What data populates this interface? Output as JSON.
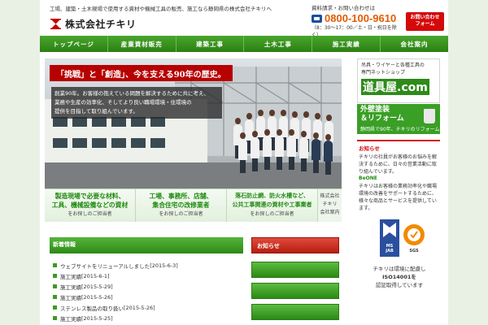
{
  "header": {
    "tagline": "工場、建築・土木現場で使用する資材や機械工具の販売、施工なら静岡県の株式会社チキリへ",
    "company_name": "株式会社チキリ",
    "contact_label": "資料請求・お問い合わせは",
    "phone": "0800-100-9610",
    "hours": "（8：30～17：00／土・日・祝日を除く）",
    "form_button": "お問い合わせ\nフォーム"
  },
  "nav": {
    "items": [
      "トップページ",
      "産業資材販売",
      "建築工事",
      "土木工事",
      "施工実績",
      "会社案内"
    ]
  },
  "hero": {
    "title": "「挑戦」と「創造」、今を支える90年の歴史。",
    "text_lines": [
      "創業90年。お客様の抱えている問題を解決するために共に考え、",
      "業務や生産の効率化、そしてより良い職場環境・住環境の",
      "提供を目指して取り組んでいます。"
    ]
  },
  "categories": [
    {
      "main": "製造現場で必要な材料、\n工具、機械設備などの資材",
      "sub": "をお探しのご担当者"
    },
    {
      "main": "工場、事務所、店舗、\n集合住宅の改修業者",
      "sub": "をお探しのご担当者"
    },
    {
      "main": "落石防止網、防火水槽など、\n公共工事関連の資材や工事業者",
      "sub": "をお探しのご担当者"
    }
  ],
  "company_info_label": "株式会社\nチキリ\n会社案内",
  "news": {
    "heading": "新着情報",
    "items": [
      {
        "title": "ウェブサイトをリニューアルしました",
        "date": "[2015-6-3]"
      },
      {
        "title": "施工実績",
        "date": "[2015-6-1]"
      },
      {
        "title": "施工実績",
        "date": "[2015-5-29]"
      },
      {
        "title": "施工実績",
        "date": "[2015-5-26]"
      },
      {
        "title": "ステンレス製品の取り扱い",
        "date": "[2015-5-26]"
      },
      {
        "title": "施工実績",
        "date": "[2015-5-25]"
      }
    ]
  },
  "mid_buttons": [
    {
      "label": "お知らせ",
      "style": "red"
    },
    {
      "label": "",
      "style": "green"
    },
    {
      "label": "",
      "style": "green"
    },
    {
      "label": "",
      "style": "green"
    }
  ],
  "sidebar": {
    "ad1_text": "吊具・ワイヤーと各種工具の\n専門ネットショップ",
    "ad1_logo": "道具屋.com",
    "ad2_main": "外壁塗装\n＆リフォーム",
    "ad2_sub": "静岡県で90年、チキリのリフォーム",
    "box_head": "お知らせ",
    "box_p1": "チキリの社員がお客様のお悩みを解決するために、日々の営業活動に取り組んでいます。",
    "box_beone": "BeONE",
    "box_p2": "チキリはお客様の業務効率化や職場環境の改善をサポートするために、様々な商品とサービスを提供しています。",
    "cert_ms": "MS\nJAB",
    "cert_sgs": "SGS",
    "cert_caption_1": "チキリは環境に配慮し",
    "cert_caption_2": "ISO14001を",
    "cert_caption_3": "認証取得しています"
  },
  "colors": {
    "accent_green": "#2d8a17",
    "accent_red": "#d40a0a",
    "phone_orange": "#e35c00"
  }
}
